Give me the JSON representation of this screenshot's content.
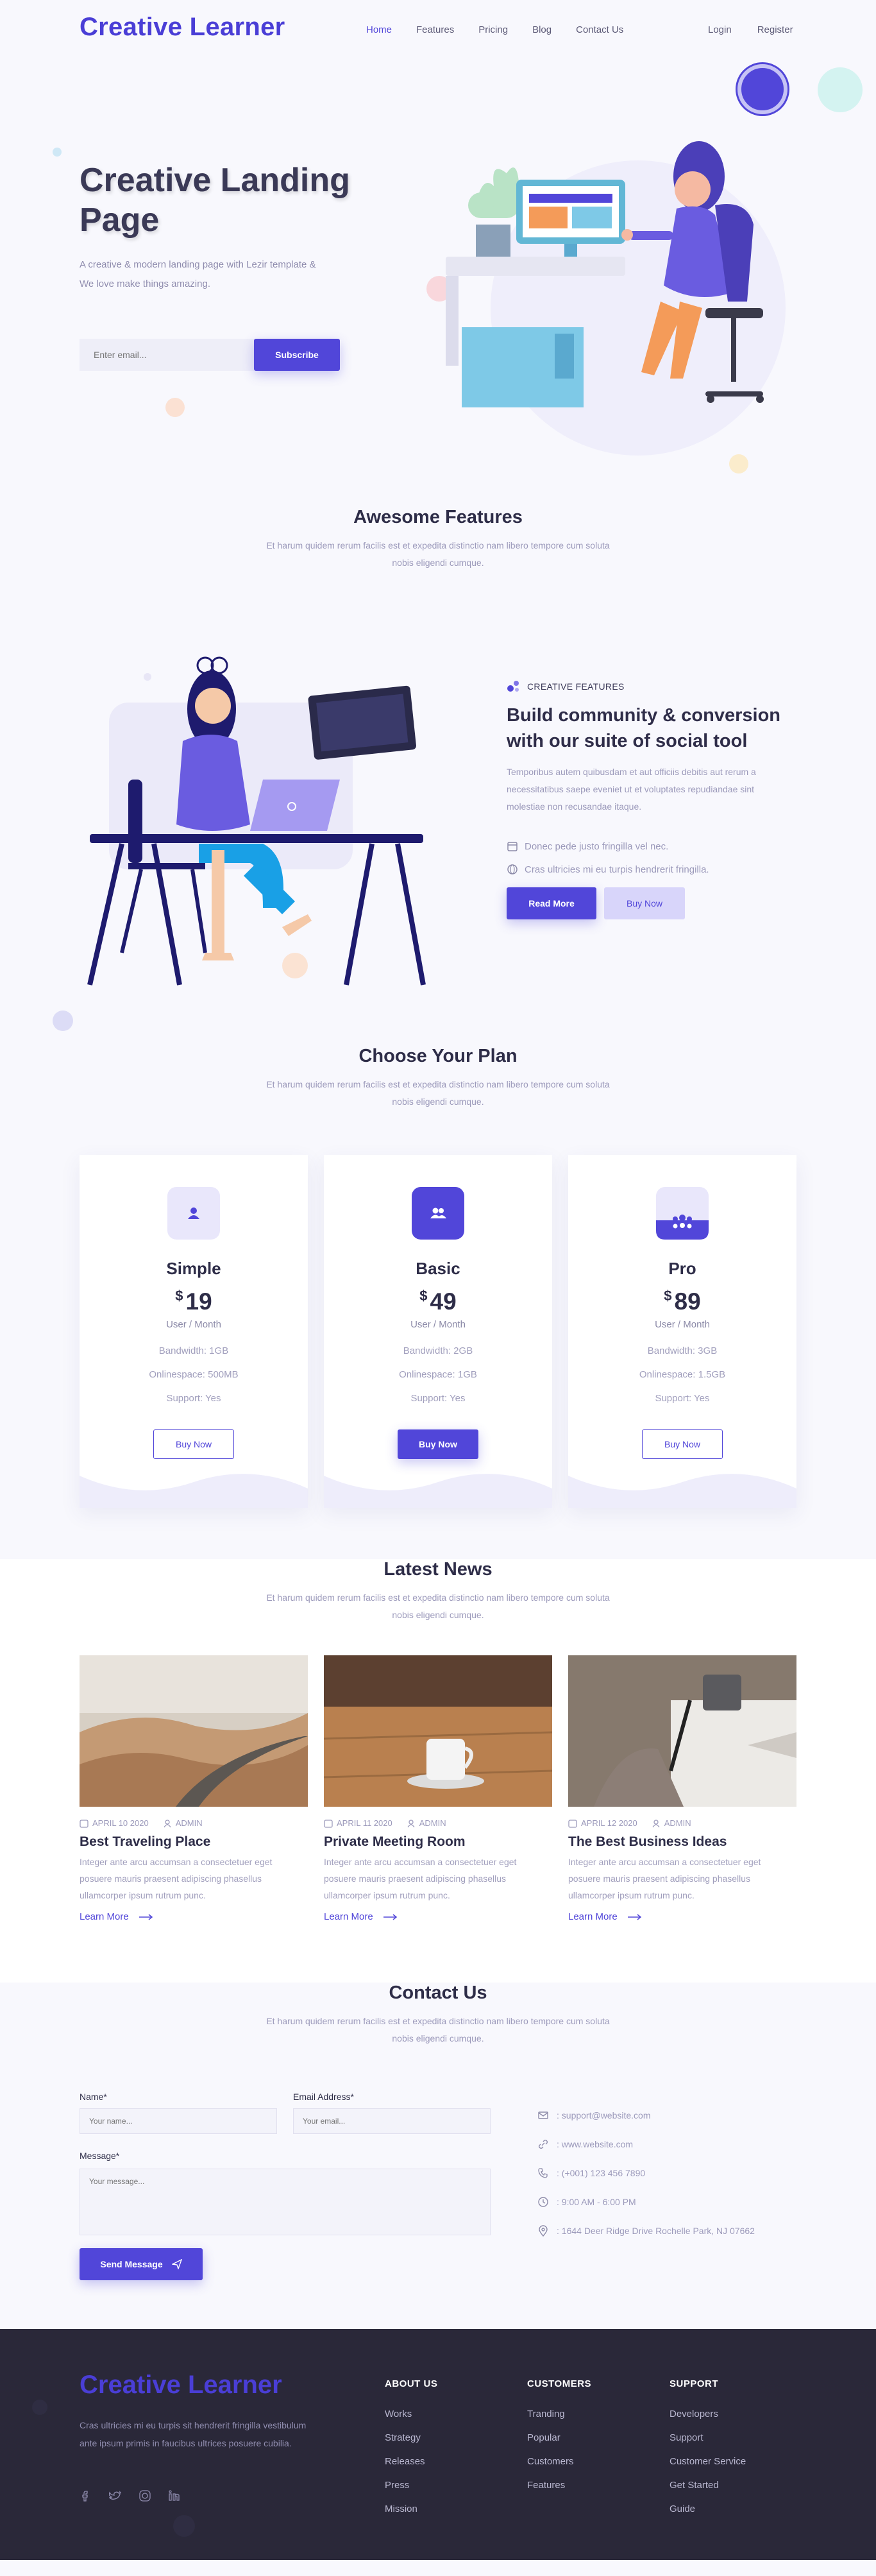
{
  "brand": "Creative Learner",
  "nav": {
    "items": [
      "Home",
      "Features",
      "Pricing",
      "Blog",
      "Contact Us"
    ],
    "login": "Login",
    "register": "Register"
  },
  "hero": {
    "title": "Creative Landing Page",
    "subtitle": "A creative & modern landing page with Lezir template & We love make things amazing.",
    "email_placeholder": "Enter email...",
    "subscribe": "Subscribe"
  },
  "features": {
    "title": "Awesome Features",
    "subtitle": "Et harum quidem rerum facilis est et expedita distinctio nam libero tempore cum soluta nobis eligendi cumque.",
    "tag": "CREATIVE FEATURES",
    "heading_1": "Build ",
    "heading_b1": "community",
    "heading_2": " & ",
    "heading_b2": "conversion",
    "heading_3": " with our suite of ",
    "heading_b3": "social tool",
    "description": "Temporibus autem quibusdam et aut officiis debitis aut rerum a necessitatibus saepe eveniet ut et voluptates repudiandae sint molestiae non recusandae itaque.",
    "items": [
      "Donec pede justo fringilla vel nec.",
      "Cras ultricies mi eu turpis hendrerit fringilla."
    ],
    "read_more": "Read More",
    "buy_now": "Buy Now",
    "accent": "#5146d9"
  },
  "pricing": {
    "title": "Choose Your Plan",
    "subtitle": "Et harum quidem rerum facilis est et expedita distinctio nam libero tempore cum soluta nobis eligendi cumque.",
    "plans": [
      {
        "name": "Simple",
        "currency": "$",
        "price": "19",
        "period": "User / Month",
        "bandwidth": "Bandwidth: 1GB",
        "space": "Onlinespace: 500MB",
        "support": "Support: Yes",
        "cta": "Buy Now",
        "icon": "user-icon"
      },
      {
        "name": "Basic",
        "currency": "$",
        "price": "49",
        "period": "User / Month",
        "bandwidth": "Bandwidth: 2GB",
        "space": "Onlinespace: 1GB",
        "support": "Support: Yes",
        "cta": "Buy Now",
        "icon": "users-icon"
      },
      {
        "name": "Pro",
        "currency": "$",
        "price": "89",
        "period": "User / Month",
        "bandwidth": "Bandwidth: 3GB",
        "space": "Onlinespace: 1.5GB",
        "support": "Support: Yes",
        "cta": "Buy Now",
        "icon": "team-icon"
      }
    ]
  },
  "news": {
    "title": "Latest News",
    "subtitle": "Et harum quidem rerum facilis est et expedita distinctio nam libero tempore cum soluta nobis eligendi cumque.",
    "posts": [
      {
        "date": "APRIL 10 2020",
        "author": "ADMIN",
        "title": "Best Traveling Place",
        "excerpt": "Integer ante arcu accumsan a consectetuer eget posuere mauris praesent adipiscing phasellus ullamcorper ipsum rutrum punc.",
        "link": "Learn More"
      },
      {
        "date": "APRIL 11 2020",
        "author": "ADMIN",
        "title": "Private Meeting Room",
        "excerpt": "Integer ante arcu accumsan a consectetuer eget posuere mauris praesent adipiscing phasellus ullamcorper ipsum rutrum punc.",
        "link": "Learn More"
      },
      {
        "date": "APRIL 12 2020",
        "author": "ADMIN",
        "title": "The Best Business Ideas",
        "excerpt": "Integer ante arcu accumsan a consectetuer eget posuere mauris praesent adipiscing phasellus ullamcorper ipsum rutrum punc.",
        "link": "Learn More"
      }
    ]
  },
  "contact": {
    "title": "Contact Us",
    "subtitle": "Et harum quidem rerum facilis est et expedita distinctio nam libero tempore cum soluta nobis eligendi cumque.",
    "name_label": "Name*",
    "name_placeholder": "Your name...",
    "email_label": "Email Address*",
    "email_placeholder": "Your email...",
    "message_label": "Message*",
    "message_placeholder": "Your message...",
    "send": "Send Message",
    "email": ": support@website.com",
    "website": ": www.website.com",
    "phone": ": (+001) 123 456 7890",
    "hours": ": 9:00 AM - 6:00 PM",
    "address": ": 1644 Deer Ridge Drive Rochelle Park, NJ 07662"
  },
  "footer": {
    "description": "Cras ultricies mi eu turpis sit hendrerit fringilla vestibulum ante ipsum primis in faucibus ultrices posuere cubilia.",
    "about": {
      "title": "ABOUT US",
      "links": [
        "Works",
        "Strategy",
        "Releases",
        "Press",
        "Mission"
      ]
    },
    "customers": {
      "title": "CUSTOMERS",
      "links": [
        "Tranding",
        "Popular",
        "Customers",
        "Features"
      ]
    },
    "support": {
      "title": "SUPPORT",
      "links": [
        "Developers",
        "Support",
        "Customer Service",
        "Get Started",
        "Guide"
      ]
    }
  }
}
